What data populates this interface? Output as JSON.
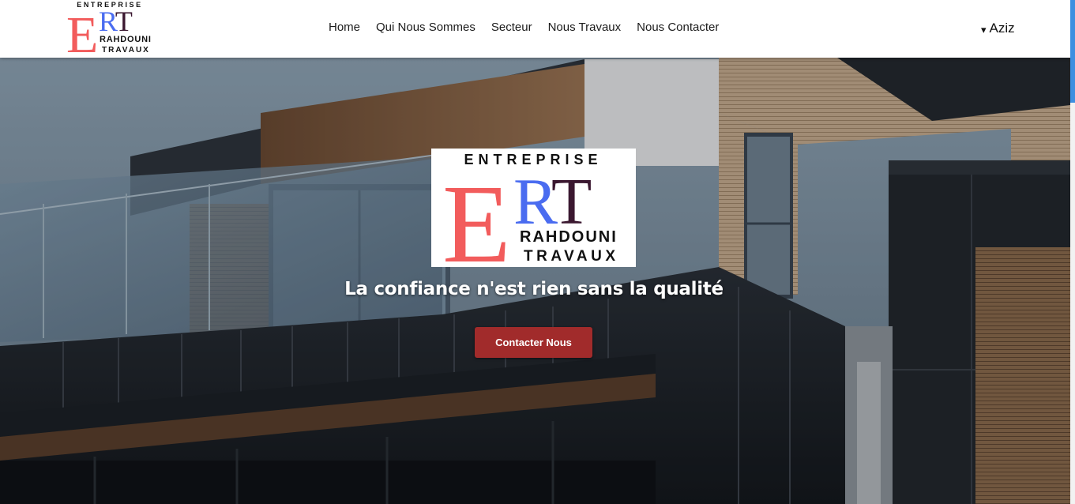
{
  "brand": {
    "line1": "ENTREPRISE",
    "letter_e": "E",
    "letters_rt": "RT",
    "line2": "RAHDOUNI",
    "line3": "TRAVAUX",
    "colors": {
      "e": "#f25c5c",
      "r": "#4a6cf0",
      "t": "#3b1830",
      "text": "#111111"
    }
  },
  "nav": {
    "items": [
      {
        "label": "Home"
      },
      {
        "label": "Qui Nous Sommes"
      },
      {
        "label": "Secteur"
      },
      {
        "label": "Nous Travaux"
      },
      {
        "label": "Nous Contacter"
      }
    ],
    "user": {
      "caret_icon": "▾",
      "name": "Aziz"
    }
  },
  "hero": {
    "tagline": "La confiance n'est rien sans la qualité",
    "cta_label": "Contacter Nous",
    "cta_color": "#a12b2b"
  }
}
